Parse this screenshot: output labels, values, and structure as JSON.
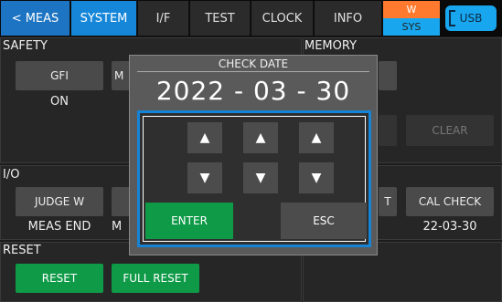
{
  "tabs": {
    "back": "< MEAS",
    "system": "SYSTEM",
    "if": "I/F",
    "test": "TEST",
    "clock": "CLOCK",
    "info": "INFO"
  },
  "status": {
    "top": "W",
    "bottom": "SYS",
    "usb": "USB"
  },
  "safety": {
    "title": "SAFETY",
    "gfi_label": "GFI",
    "gfi_value": "ON",
    "partial_btn": "M"
  },
  "memory": {
    "title": "MEMORY",
    "clear_label": "CLEAR"
  },
  "io": {
    "title": "I/O",
    "judge_label": "JUDGE W",
    "judge_value": "MEAS END",
    "partial_btn_value": "M",
    "partial_right": "T",
    "cal_label": "CAL CHECK",
    "cal_value": "22-03-30"
  },
  "reset": {
    "title": "RESET",
    "reset_label": "RESET",
    "full_reset_label": "FULL RESET"
  },
  "dialog": {
    "title": "CHECK DATE",
    "date": "2022 - 03 - 30",
    "up_glyph": "▲",
    "down_glyph": "▼",
    "enter_label": "ENTER",
    "esc_label": "ESC"
  },
  "colors": {
    "accent": "#1687d8",
    "green": "#0f9a48",
    "orange": "#ff7a2e"
  }
}
